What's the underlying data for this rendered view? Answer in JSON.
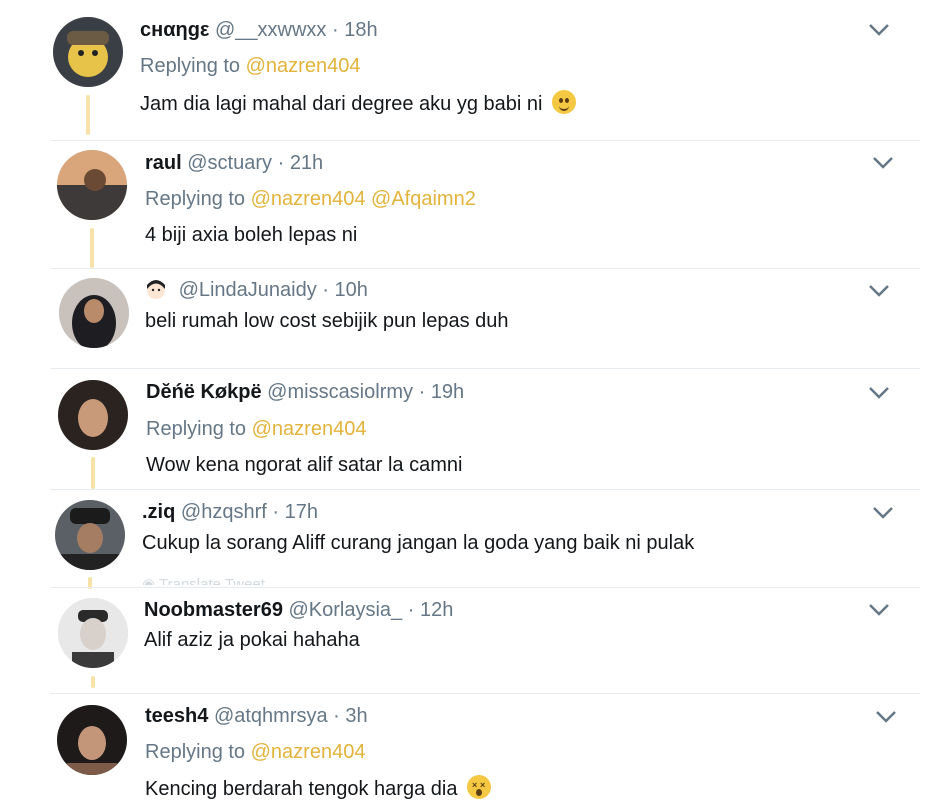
{
  "tweets": [
    {
      "name": "cнαηgε",
      "handle": "@__xxwwxx",
      "time": "18h",
      "replying_label": "Replying to",
      "mentions": [
        "@nazren404"
      ],
      "text": "Jam dia lagi mahal dari degree aku yg babi ni",
      "emoji": "slightly-smiling-face"
    },
    {
      "name": "raul",
      "handle": "@sctuary",
      "time": "21h",
      "replying_label": "Replying to",
      "mentions": [
        "@nazren404",
        "@Afqaimn2"
      ],
      "text": "4 biji axia boleh lepas ni"
    },
    {
      "name": "",
      "handle": "@LindaJunaidy",
      "time": "10h",
      "text": "beli rumah low cost sebijik pun lepas duh",
      "name_icon": "girl-emoji-icon"
    },
    {
      "name": "Dĕńë Køkpë",
      "handle": "@misscasiolrmy",
      "time": "19h",
      "replying_label": "Replying to",
      "mentions": [
        "@nazren404"
      ],
      "text": "Wow kena ngorat alif satar la camni"
    },
    {
      "name": ".ziq",
      "handle": "@hzqshrf",
      "time": "17h",
      "text": "Cukup la sorang Aliff curang jangan la goda yang baik ni pulak",
      "footer": "Translate Tweet"
    },
    {
      "name": "Noobmaster69",
      "handle": "@Korlaysia_",
      "time": "12h",
      "text": "Alif aziz ja pokai hahaha"
    },
    {
      "name": "teesh4",
      "handle": "@atqhmrsya",
      "time": "3h",
      "replying_label": "Replying to",
      "mentions": [
        "@nazren404"
      ],
      "text": "Kencing berdarah tengok harga dia",
      "emoji": "dizzy-face"
    }
  ],
  "separator_dot": "·",
  "colors": {
    "mention": "#e3b33b",
    "thread_line": "#f7e2a8",
    "secondary_text": "#657786"
  }
}
